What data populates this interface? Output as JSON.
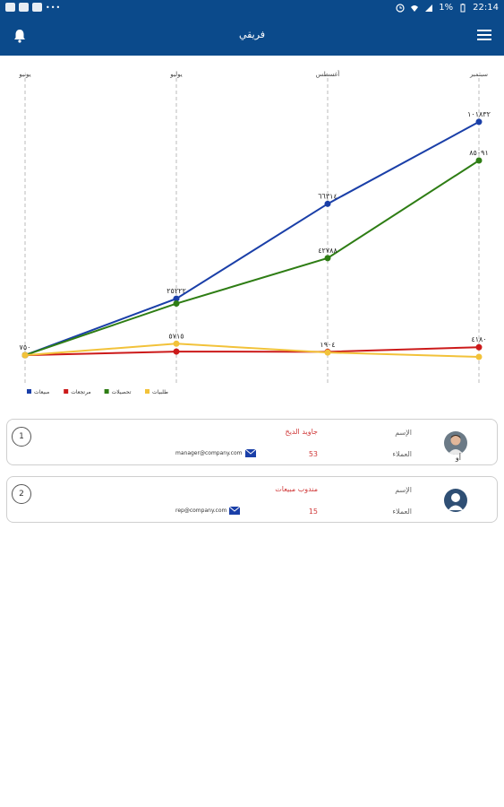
{
  "statusbar": {
    "battery": "1%",
    "time": "22:14"
  },
  "appbar": {
    "title": "فريقي"
  },
  "chart_data": {
    "type": "line",
    "categories": [
      "يونيو",
      "يوليو",
      "أغسطس",
      "سبتمبر"
    ],
    "series": [
      {
        "name": "مبيعات",
        "color": "#1a3fa8",
        "values": [
          750,
          25222,
          66314,
          101832
        ],
        "labels": [
          "٧٥٠",
          "٢٥٢٢٢",
          "٦٦٣١٤",
          "١٠١٨٣٢"
        ]
      },
      {
        "name": "مرتجعات",
        "color": "#cc1a1a",
        "values": [
          750,
          2300,
          2200,
          4180
        ],
        "labels": [
          "",
          "",
          "",
          "٤١٨٠"
        ]
      },
      {
        "name": "تحصيلات",
        "color": "#2e7d14",
        "values": [
          750,
          23100,
          42788,
          85091
        ],
        "labels": [
          "",
          "",
          "٤٢٧٨٨",
          "٨٥٠٩١"
        ]
      },
      {
        "name": "طلبيات",
        "color": "#f2c23a",
        "values": [
          750,
          5715,
          1904,
          0
        ],
        "labels": [
          "",
          "٥٧١٥",
          "١٩٠٤",
          ""
        ]
      }
    ],
    "ylim": [
      0,
      115000
    ],
    "legend_position": "bottom-left",
    "grid": "vertical-dashed"
  },
  "team": [
    {
      "number": "1",
      "label_name": "الإسم",
      "name": "جاويد الديخ",
      "label_clients": "العملاء",
      "clients": "53",
      "email": "manager@company.com",
      "extra": "أو"
    },
    {
      "number": "2",
      "label_name": "الإسم",
      "name": "مندوب مبيعات",
      "label_clients": "العملاء",
      "clients": "15",
      "email": "rep@company.com",
      "extra": ""
    }
  ]
}
